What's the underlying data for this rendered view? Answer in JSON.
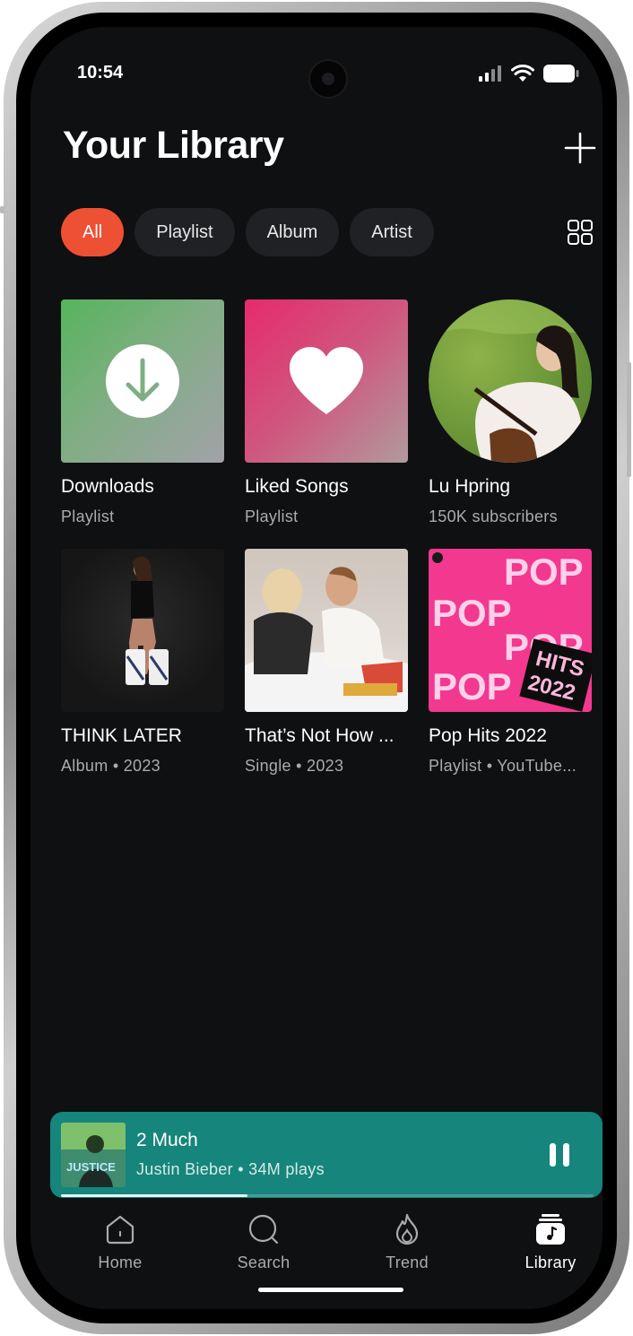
{
  "status_bar": {
    "time": "10:54"
  },
  "header": {
    "title": "Your Library",
    "add_icon": "plus-icon",
    "view_icon": "grid-view-icon"
  },
  "filters": [
    {
      "label": "All",
      "active": true
    },
    {
      "label": "Playlist",
      "active": false
    },
    {
      "label": "Album",
      "active": false
    },
    {
      "label": "Artist",
      "active": false
    }
  ],
  "library": [
    {
      "title": "Downloads",
      "subtitle": "Playlist",
      "art": "download-icon"
    },
    {
      "title": "Liked Songs",
      "subtitle": "Playlist",
      "art": "heart-icon"
    },
    {
      "title": "Lu Hpring",
      "subtitle": "150K subscribers",
      "art": "artist-photo"
    },
    {
      "title": "THINK LATER",
      "subtitle": "Album • 2023",
      "art": "album-cover"
    },
    {
      "title": "That’s Not How ...",
      "subtitle": "Single • 2023",
      "art": "single-cover"
    },
    {
      "title": "Pop Hits 2022",
      "subtitle": "Playlist • YouTube...",
      "art": "playlist-cover"
    }
  ],
  "pop_cover": {
    "word": "POP",
    "badge_line1": "HITS",
    "badge_line2": "2022"
  },
  "mini_player": {
    "title": "2 Much",
    "subtitle": "Justin Bieber • 34M plays",
    "progress": 0.35,
    "art_text": "JUSTICE",
    "colors": {
      "background": "#16857c"
    }
  },
  "nav": [
    {
      "label": "Home",
      "icon": "home-icon",
      "active": false
    },
    {
      "label": "Search",
      "icon": "search-icon",
      "active": false
    },
    {
      "label": "Trend",
      "icon": "flame-icon",
      "active": false
    },
    {
      "label": "Library",
      "icon": "library-icon",
      "active": true
    }
  ],
  "colors": {
    "accent": "#ee5033",
    "screen": "#0f1012"
  }
}
